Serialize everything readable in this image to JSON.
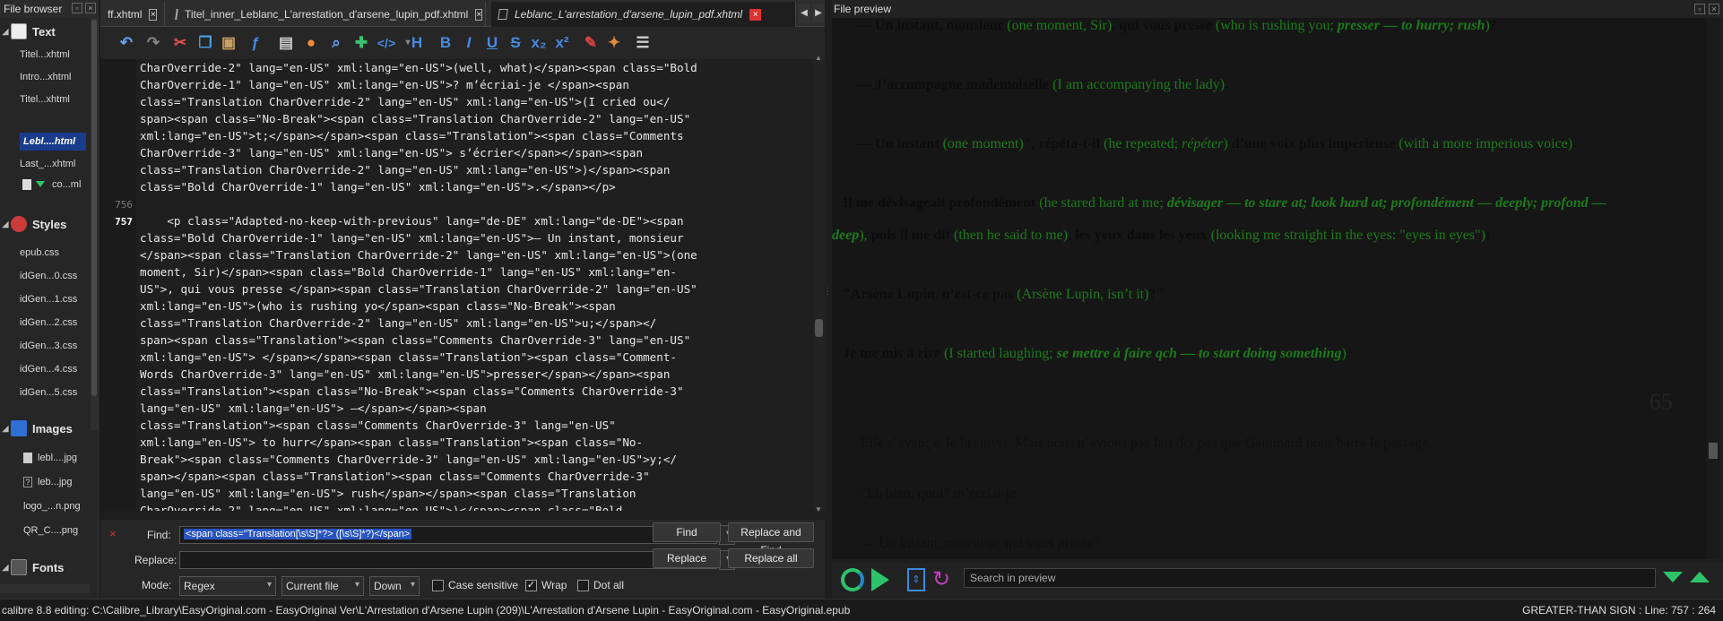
{
  "file_browser": {
    "title": "File browser",
    "sections": {
      "text": "Text",
      "styles": "Styles",
      "images": "Images",
      "fonts": "Fonts"
    },
    "text_items": [
      "Titel...xhtml",
      "Intro...xhtml",
      "Titel...xhtml",
      "Lebl....html",
      "Last_...xhtml",
      "co...ml"
    ],
    "style_items": [
      "epub.css",
      "idGen...0.css",
      "idGen...1.css",
      "idGen...2.css",
      "idGen...3.css",
      "idGen...4.css",
      "idGen...5.css"
    ],
    "image_items": [
      "lebl....jpg",
      "leb...jpg",
      "logo_...n.png",
      "QR_C....png"
    ]
  },
  "tabs": [
    {
      "label": "ff.xhtml"
    },
    {
      "label": "Titel_inner_Leblanc_L'arrestation_d'arsene_lupin_pdf.xhtml"
    },
    {
      "label": "Leblanc_L'arrestation_d'arsene_lupin_pdf.xhtml"
    }
  ],
  "toolbar_icons": [
    "undo-icon",
    "redo-icon",
    "cut-icon",
    "copy-icon",
    "paste-icon",
    "magic-icon",
    "image-icon",
    "marker-icon",
    "check-icon",
    "insert-icon",
    "tag-icon",
    "heading-icon",
    "bold-icon",
    "italic-icon",
    "underline-icon",
    "strike-icon",
    "subscript-icon",
    "superscript-icon",
    "eraser-icon",
    "paint-icon",
    "align-icon"
  ],
  "editor": {
    "line_numbers": {
      "a": "756",
      "b": "757"
    },
    "lines": [
      "CharOverride-2\" lang=\"en-US\" xml:lang=\"en-US\">(well, what)</span><span class=\"Bold",
      "CharOverride-1\" lang=\"en-US\" xml:lang=\"en-US\">? m’écriai-je </span><span",
      "class=\"Translation CharOverride-2\" lang=\"en-US\" xml:lang=\"en-US\">(I cried ou</",
      "span><span class=\"No-Break\"><span class=\"Translation CharOverride-2\" lang=\"en-US\"",
      "xml:lang=\"en-US\">t;</span></span><span class=\"Translation\"><span class=\"Comments",
      "CharOverride-3\" lang=\"en-US\" xml:lang=\"en-US\"> s’écrier</span></span><span",
      "class=\"Translation CharOverride-2\" lang=\"en-US\" xml:lang=\"en-US\">)</span><span",
      "class=\"Bold CharOverride-1\" lang=\"en-US\" xml:lang=\"en-US\">.</span></p>",
      "",
      "    <p class=\"Adapted-no-keep-with-previous\" lang=\"de-DE\" xml:lang=\"de-DE\"><span",
      "class=\"Bold CharOverride-1\" lang=\"en-US\" xml:lang=\"en-US\">— Un instant, monsieur",
      "</span><span class=\"Translation CharOverride-2\" lang=\"en-US\" xml:lang=\"en-US\">(one",
      "moment, Sir)</span><span class=\"Bold CharOverride-1\" lang=\"en-US\" xml:lang=\"en-",
      "US\">, qui vous presse </span><span class=\"Translation CharOverride-2\" lang=\"en-US\"",
      "xml:lang=\"en-US\">(who is rushing yo</span><span class=\"No-Break\"><span",
      "class=\"Translation CharOverride-2\" lang=\"en-US\" xml:lang=\"en-US\">u;</span></",
      "span><span class=\"Translation\"><span class=\"Comments CharOverride-3\" lang=\"en-US\"",
      "xml:lang=\"en-US\"> </span></span><span class=\"Translation\"><span class=\"Comment-",
      "Words CharOverride-3\" lang=\"en-US\" xml:lang=\"en-US\">presser</span></span><span",
      "class=\"Translation\"><span class=\"No-Break\"><span class=\"Comments CharOverride-3\"",
      "lang=\"en-US\" xml:lang=\"en-US\"> —</span></span><span",
      "class=\"Translation\"><span class=\"Comments CharOverride-3\" lang=\"en-US\"",
      "xml:lang=\"en-US\"> to hurr</span><span class=\"Translation\"><span class=\"No-",
      "Break\"><span class=\"Comments CharOverride-3\" lang=\"en-US\" xml:lang=\"en-US\">y;</",
      "span></span><span class=\"Translation\"><span class=\"Comments CharOverride-3\"",
      "lang=\"en-US\" xml:lang=\"en-US\"> rush</span></span><span class=\"Translation",
      "CharOverride-2\" lang=\"en-US\" xml:lang=\"en-US\">)</span><span class=\"Bold"
    ]
  },
  "find_bar": {
    "find_label": "Find:",
    "find_value": "<span class=\"Translation[\\s\\S]*?> ([\\s\\S]*?)</span>",
    "replace_label": "Replace:",
    "replace_value": "",
    "find_button": "Find",
    "replace_and_find_button": "Replace and Find",
    "replace_button": "Replace",
    "replace_all_button": "Replace all",
    "mode_label": "Mode:",
    "mode_value": "Regex",
    "scope_value": "Current file",
    "direction_value": "Down",
    "case_sensitive": "Case sensitive",
    "wrap": "Wrap",
    "dot_all": "Dot all"
  },
  "preview": {
    "title": "File preview",
    "page_number": "65",
    "search_placeholder": "Search in preview",
    "p1": {
      "a": "— Un instant, monsieur ",
      "b": "(one moment, Sir)",
      "c": ", qui vous presse ",
      "d": "(who is rushing you; ",
      "e": "presser — to hurry; rush",
      "f": ")",
      "g": "?"
    },
    "p2": {
      "a": "— J’accompagne mademoiselle ",
      "b": "(I am accompanying the lady)",
      "c": "."
    },
    "p3": {
      "a": "— Un instant ",
      "b": "(one moment)",
      "c": "\", répéta-t-il ",
      "d": "(he repeated; ",
      "e": "répéter",
      "f": ") ",
      "g": "d’une voix plus impérieuse ",
      "h": "(with a more imperious voice)",
      "i": "."
    },
    "p4": {
      "a": "Il me dévisageait profondément ",
      "b": "(he stared hard at me; ",
      "c": "dévisager — to stare at; look hard at; profondément — deeply; profond —",
      "d": "deep",
      "e": "), ",
      "f": "puis il me dit ",
      "g": "(then he said to me)",
      "h": ", les yeux dans les yeux ",
      "i": "(looking me straight in the eyes: \"eyes in eyes\")",
      "j": ":"
    },
    "p5": {
      "a": "\"Arsène Lupin, n’est-ce pas ",
      "b": "(Arsène Lupin, isn’t it)",
      "c": "?\""
    },
    "p6": {
      "a": "Je me mis à rire ",
      "b": "(I started laughing; ",
      "c": "se mettre à faire qch — to start doing something",
      "d": ")",
      "e": "."
    },
    "p7": "Elle s’avança. Je la suivis. Mais nous n’avions pas fait dix pas que Ganimard nous barra le passage.",
    "p8": "\"Eh bien, quoi? m’écriai-je.",
    "p9": "— Un instant, monsieur, qui vous presse?"
  },
  "status": {
    "left": "calibre 8.8 editing: C:\\Calibre_Library\\EasyOriginal.com - EasyOriginal Ver\\L'Arrestation d'Arsene Lupin (209)\\L'Arrestation d'Arsene Lupin - EasyOriginal.com - EasyOriginal.epub",
    "right": "GREATER-THAN SIGN : Line: 757 : 264"
  }
}
